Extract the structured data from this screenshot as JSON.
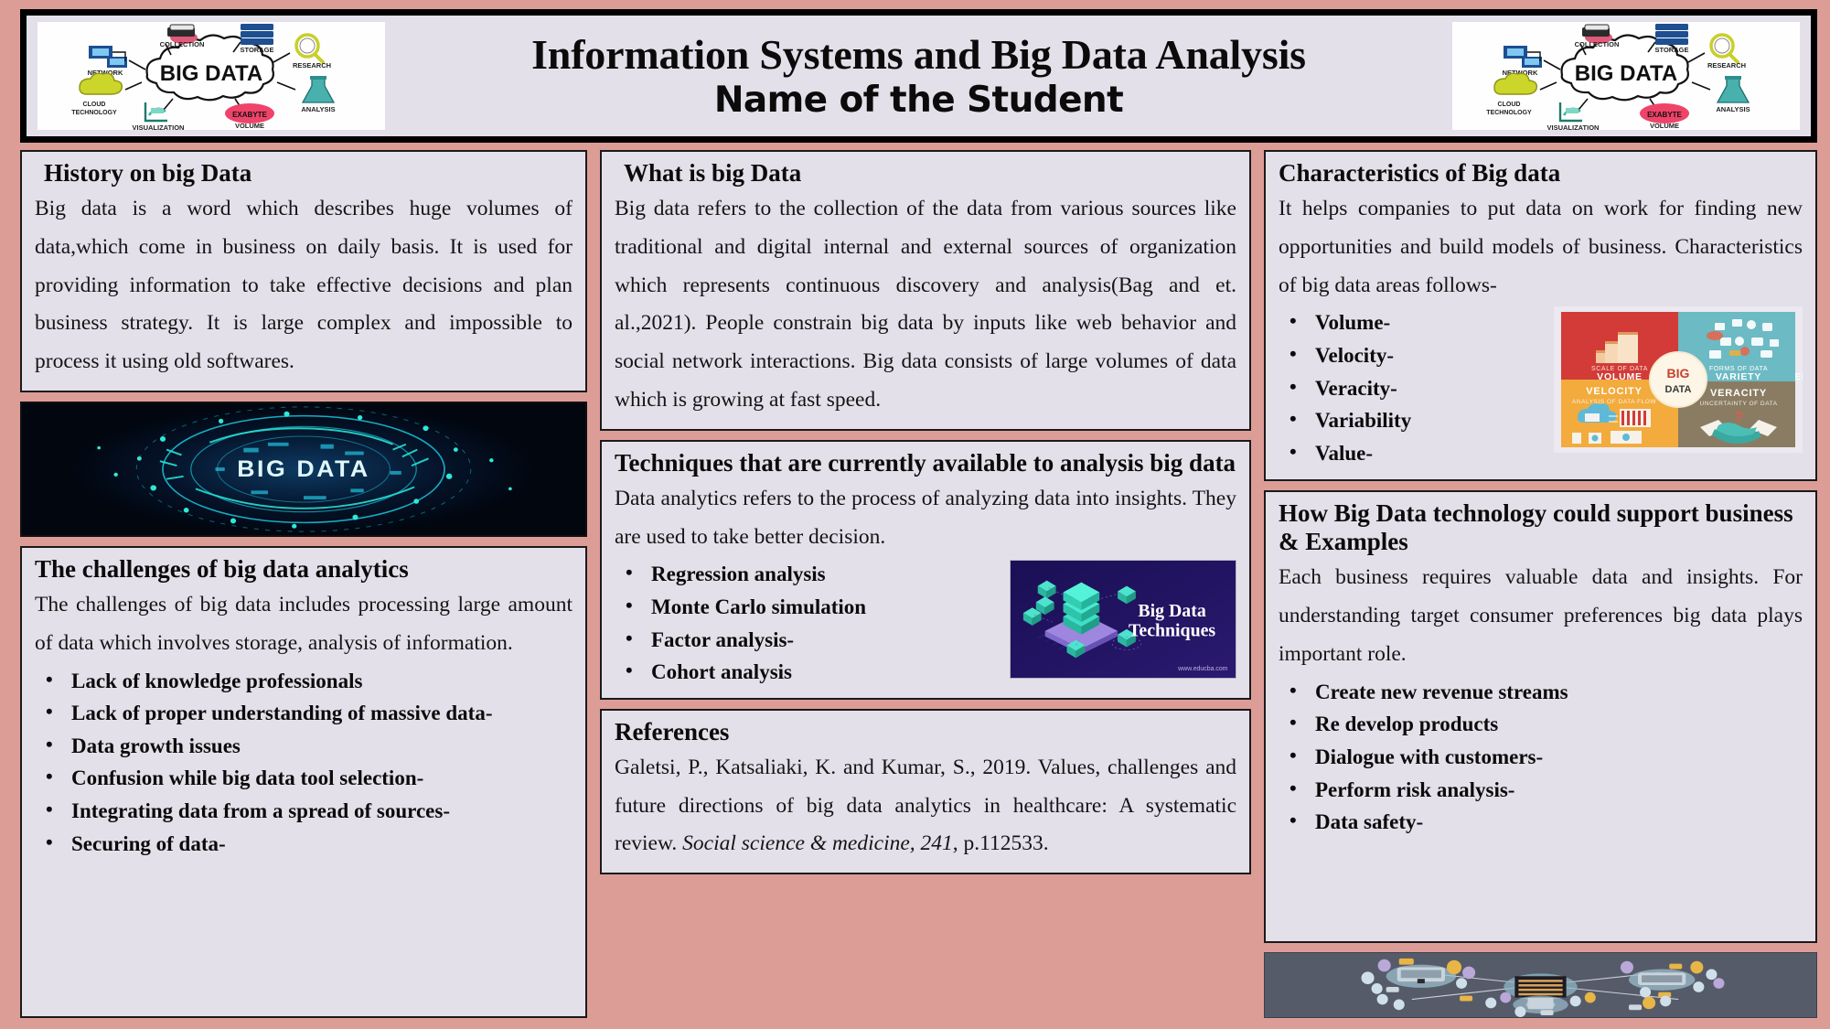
{
  "header": {
    "title": "Information Systems and Big Data Analysis",
    "subtitle": "Name of the Student",
    "figure_left": {
      "name": "big-data-cloud-diagram",
      "center_label": "BIG DATA",
      "node_labels": [
        "NETWORK",
        "COLLECTION",
        "STORAGE",
        "RESEARCH",
        "ANALYSIS",
        "VOLUME",
        "VISUALIZATION",
        "CLOUD TECHNOLOGY"
      ],
      "volume_badge": "EXABYTE"
    },
    "figure_right": {
      "name": "big-data-cloud-diagram",
      "center_label": "BIG DATA",
      "node_labels": [
        "NETWORK",
        "COLLECTION",
        "STORAGE",
        "RESEARCH",
        "ANALYSIS",
        "VOLUME",
        "VISUALIZATION",
        "CLOUD TECHNOLOGY"
      ],
      "volume_badge": "EXABYTE"
    }
  },
  "history": {
    "title": "History on big Data",
    "body": "Big data is a word which describes huge volumes of data,which come in business on daily basis. It is used for providing information to take effective decisions and plan business strategy. It is large complex and impossible to process it using old softwares."
  },
  "circuit_image": {
    "name": "big-data-circuit-image",
    "label": "BIG DATA"
  },
  "challenges": {
    "title": "The challenges of big data analytics",
    "body": "The challenges of big data includes processing large amount of data which involves storage, analysis of information.",
    "bullets": [
      "Lack of knowledge professionals",
      "Lack of proper understanding of massive data-",
      "Data growth issues",
      "Confusion while big data tool selection-",
      "Integrating data from a spread of sources-",
      "Securing of data-"
    ]
  },
  "what_is": {
    "title": "What is big Data",
    "body": "Big data refers to the collection of the data from various sources like traditional and digital internal and external sources of organization which represents continuous discovery and analysis(Bag and et. al.,2021). People constrain big data by inputs like web behavior and social network interactions. Big data consists of large volumes of data which is growing at fast speed."
  },
  "techniques": {
    "title": "Techniques that are currently available to analysis big data",
    "body": "Data analytics refers to the process of analyzing data into insights. They are used to take better decision.",
    "bullets": [
      "Regression analysis",
      "Monte Carlo simulation",
      "Factor analysis-",
      "Cohort analysis"
    ],
    "figure": {
      "name": "big-data-techniques-image",
      "title_line1": "Big Data",
      "title_line2": "Techniques",
      "watermark": "www.educba.com"
    }
  },
  "references": {
    "title": "References",
    "text_part1": "Galetsi, P., Katsaliaki, K. and Kumar, S., 2019. Values, challenges and future directions of big data analytics in healthcare: A systematic review. ",
    "journal": "Social science & medicine, 241",
    "text_part2": ", p.112533."
  },
  "characteristics": {
    "title": "Characteristics of Big data",
    "body": "It helps companies to put data on work for finding new opportunities and build models of business. Characteristics of big data areas follows-",
    "bullets": [
      "Volume-",
      "Velocity-",
      "Veracity-",
      "Variability",
      "Value-"
    ],
    "figure": {
      "name": "four-v-big-data-infographic",
      "center_label_top": "BIG",
      "center_label_bottom": "DATA",
      "quadrants": [
        {
          "sub": "SCALE OF DATA",
          "label": "VOLUME",
          "color": "#d23b38"
        },
        {
          "sub": "FORMS OF DATA",
          "label": "VARIETY",
          "color": "#6cbac4"
        },
        {
          "sub": "ANALYSIS OF DATA FLOW",
          "label": "VELOCITY",
          "color": "#f2ab3c"
        },
        {
          "sub": "UNCERTAINTY OF DATA",
          "label": "VERACITY",
          "color": "#8a7c63"
        }
      ]
    }
  },
  "support": {
    "title": "How Big Data technology could support business & Examples",
    "body": "Each business requires valuable data and insights. For understanding target consumer preferences big data plays important role.",
    "bullets": [
      "Create new revenue streams",
      "Re develop products",
      "Dialogue with customers-",
      "Perform risk analysis-",
      "Data safety-"
    ]
  },
  "network_image": {
    "name": "data-network-topology-image"
  },
  "colors": {
    "poster_background": "#dd9d97",
    "panel_background": "#e4e0ea",
    "panel_border": "#1a1a1a",
    "text": "#141414"
  }
}
